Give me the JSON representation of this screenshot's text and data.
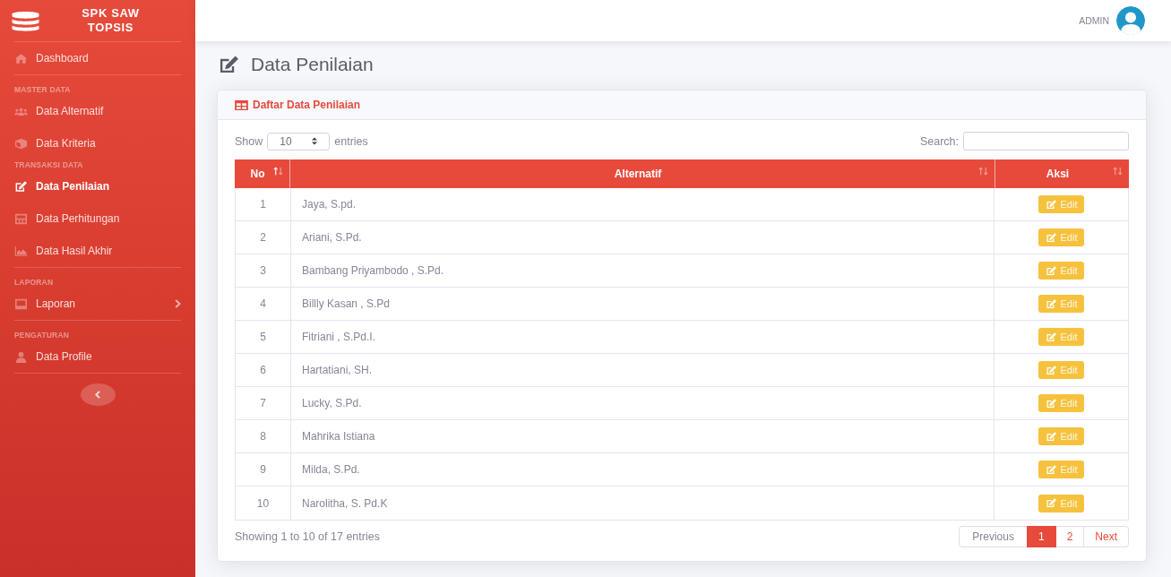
{
  "sidebar": {
    "brand": {
      "lines": [
        "SPK SAW",
        "TOPSIS"
      ]
    },
    "sections": [
      {
        "divider": true,
        "items": [
          {
            "kind": "link",
            "label": "Dashboard",
            "selected": false
          }
        ]
      },
      {
        "divider": true,
        "heading": "MASTER DATA",
        "items": [
          {
            "kind": "link",
            "label": "Data Alternatif",
            "selected": false
          },
          {
            "kind": "link",
            "label": "Data Kriteria",
            "selected": false
          }
        ]
      },
      {
        "divider": false,
        "heading": "TRANSAKSI DATA",
        "items": [
          {
            "kind": "link",
            "label": "Data Penilaian",
            "selected": true
          },
          {
            "kind": "link",
            "label": "Data Perhitungan",
            "selected": false
          },
          {
            "kind": "link",
            "label": "Data Hasil Akhir",
            "selected": false
          }
        ]
      },
      {
        "divider": true,
        "heading": "LAPORAN",
        "items": [
          {
            "kind": "submenu",
            "label": "Laporan",
            "selected": false
          }
        ]
      },
      {
        "divider": true,
        "heading": "PENGATURAN",
        "items": [
          {
            "kind": "link",
            "label": "Data Profile",
            "selected": false
          }
        ]
      }
    ]
  },
  "topbar": {
    "user": "ADMIN"
  },
  "page": {
    "title": "Data Penilaian"
  },
  "card": {
    "title": "Daftar Data Penilaian",
    "length_menu": {
      "label": "Show",
      "value": "10",
      "suffix": "entries"
    },
    "search": {
      "label": "Search:"
    },
    "table": {
      "columns": [
        {
          "label": "No",
          "sorted": true
        },
        {
          "label": "Alternatif",
          "sorted": false
        },
        {
          "label": "Aksi",
          "sorted": false
        }
      ],
      "rows": [
        {
          "no": "1",
          "alternatif": "Jaya, S.pd.",
          "action": "Edit"
        },
        {
          "no": "2",
          "alternatif": "Ariani, S.Pd.",
          "action": "Edit"
        },
        {
          "no": "3",
          "alternatif": "Bambang Priyambodo , S.Pd.",
          "action": "Edit"
        },
        {
          "no": "4",
          "alternatif": "Billly Kasan , S.Pd",
          "action": "Edit"
        },
        {
          "no": "5",
          "alternatif": "Fitriani , S.Pd.I.",
          "action": "Edit"
        },
        {
          "no": "6",
          "alternatif": "Hartatiani, SH.",
          "action": "Edit"
        },
        {
          "no": "7",
          "alternatif": "Lucky, S.Pd.",
          "action": "Edit"
        },
        {
          "no": "8",
          "alternatif": "Mahrika Istiana",
          "action": "Edit"
        },
        {
          "no": "9",
          "alternatif": "Milda, S.Pd.",
          "action": "Edit"
        },
        {
          "no": "10",
          "alternatif": "Narolitha, S. Pd.K",
          "action": "Edit"
        }
      ]
    },
    "info": "Showing 1 to 10 of 17 entries",
    "pagination": [
      {
        "label": "Previous",
        "selected": false,
        "disabled": true
      },
      {
        "label": "1",
        "selected": true,
        "disabled": false
      },
      {
        "label": "2",
        "selected": false,
        "disabled": false
      },
      {
        "label": "Next",
        "selected": false,
        "disabled": false
      }
    ]
  }
}
